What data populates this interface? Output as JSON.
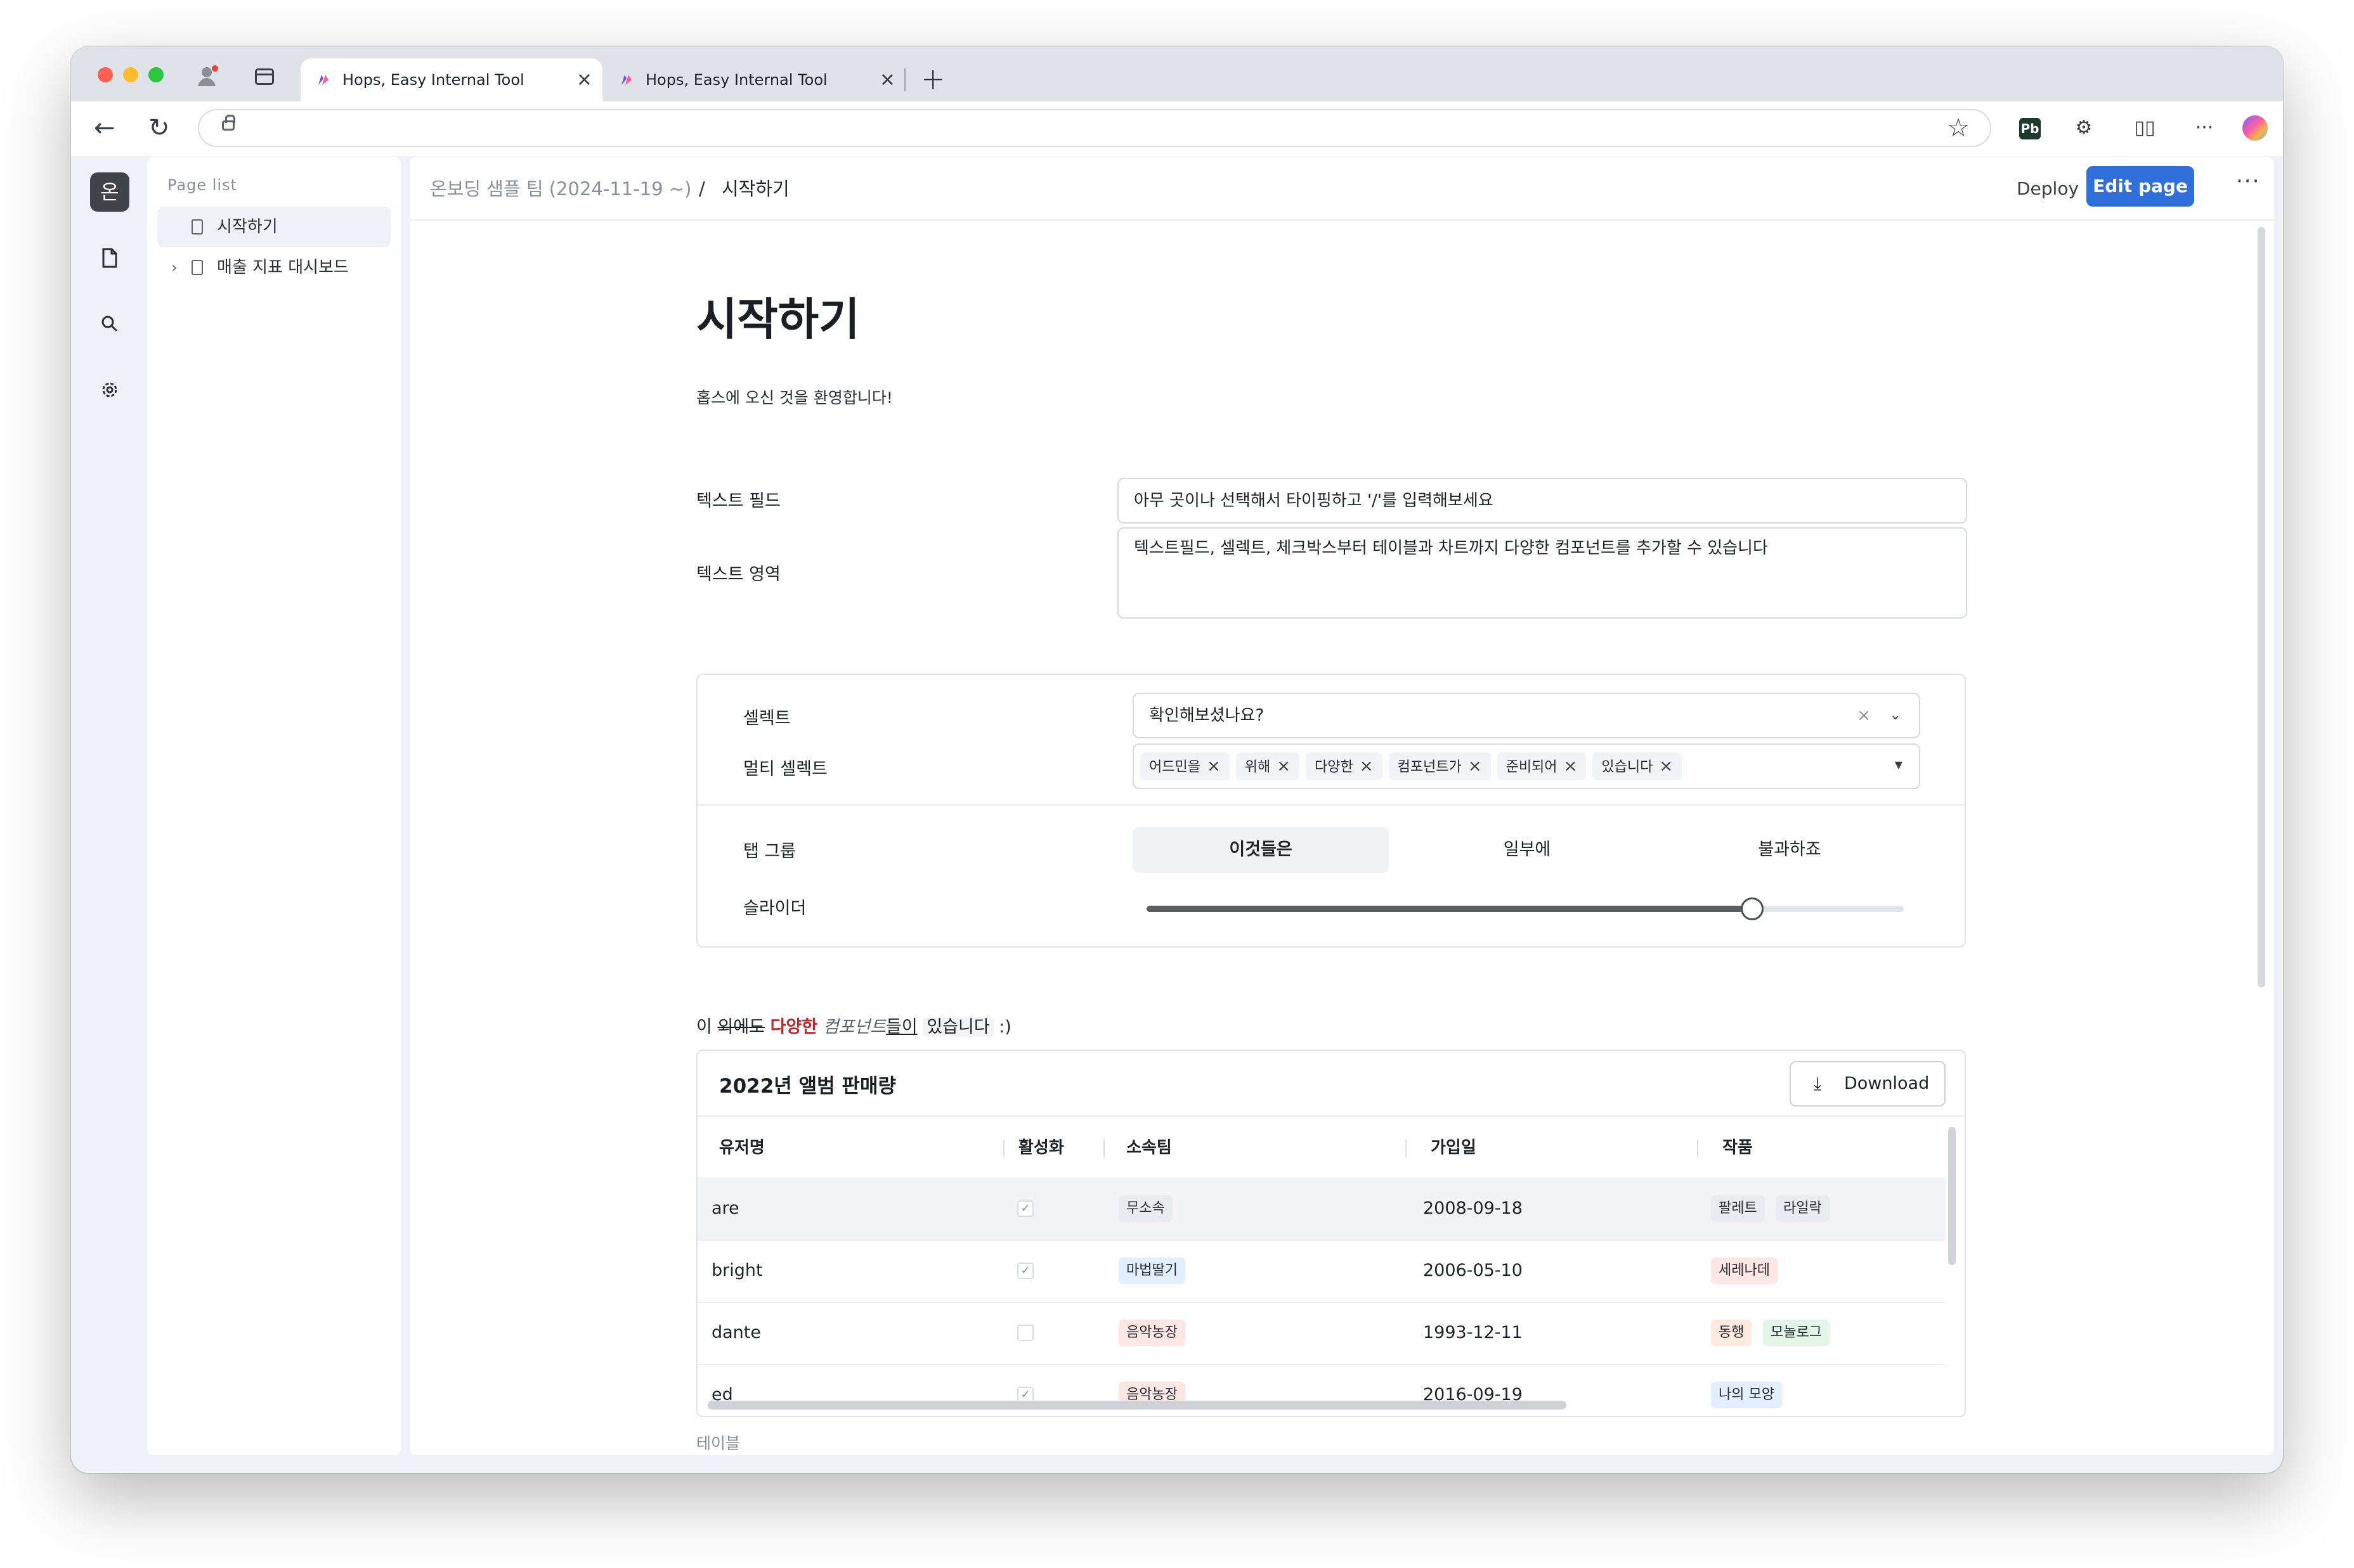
{
  "browser": {
    "tabs": [
      {
        "title": "Hops, Easy Internal Tool",
        "active": true
      },
      {
        "title": "Hops, Easy Internal Tool",
        "active": false
      }
    ],
    "address": ""
  },
  "sidebar_rail": {
    "workspace_initial": "온",
    "items": [
      "doc-icon",
      "search-icon",
      "gear-icon"
    ]
  },
  "page_list": {
    "title": "Page list",
    "items": [
      {
        "label": "시작하기",
        "selected": true
      },
      {
        "label": "매출 지표 대시보드",
        "selected": false
      }
    ]
  },
  "topbar": {
    "team": "온보딩 샘플 팀 (2024-11-19 ~)",
    "separator": "/",
    "current_page": "시작하기",
    "deploy_label": "Deploy",
    "edit_label": "Edit page",
    "more_label": "···"
  },
  "content": {
    "heading": "시작하기",
    "welcome": "홉스에 오신 것을 환영합니다!",
    "text_field": {
      "label": "텍스트 필드",
      "value": "아무 곳이나 선택해서 타이핑하고 '/'를 입력해보세요"
    },
    "text_area": {
      "label": "텍스트 영역",
      "value": "텍스트필드, 셀렉트, 체크박스부터 테이블과 차트까지 다양한 컴포넌트를 추가할 수 있습니다"
    },
    "select": {
      "label": "셀렉트",
      "value": "확인해보셨나요?"
    },
    "multi_select": {
      "label": "멀티 셀렉트",
      "chips": [
        "어드민을",
        "위해",
        "다양한",
        "컴포넌트가",
        "준비되어",
        "있습니다"
      ]
    },
    "tab_group": {
      "label": "탭 그룹",
      "options": [
        "이것들은",
        "일부에",
        "불과하죠"
      ],
      "selected_index": 0
    },
    "slider": {
      "label": "슬라이더",
      "value_fraction": 0.8
    },
    "rich_text": {
      "t1": "이 ",
      "t2": "외에도",
      "t3": " ",
      "t4": "다양한",
      "t5": " ",
      "t6": "컴포넌트",
      "t7": "들이",
      "t8": " ",
      "t9": "있습니다",
      "t10": " :)"
    }
  },
  "table": {
    "title": "2022년 앨범 판매량",
    "download_label": "Download",
    "columns": [
      "유저명",
      "활성화",
      "소속팀",
      "가입일",
      "작품"
    ],
    "rows": [
      {
        "user": "are",
        "active": true,
        "team": "무소속",
        "joined": "2008-09-18",
        "works": [
          "팔레트",
          "라일락"
        ]
      },
      {
        "user": "bright",
        "active": true,
        "team": "마법딸기",
        "joined": "2006-05-10",
        "works": [
          "세레나데"
        ]
      },
      {
        "user": "dante",
        "active": false,
        "team": "음악농장",
        "joined": "1993-12-11",
        "works": [
          "동행",
          "모놀로그"
        ]
      },
      {
        "user": "ed",
        "active": true,
        "team": "음악농장",
        "joined": "2016-09-19",
        "works": [
          "나의 모양"
        ]
      }
    ],
    "caption": "테이블"
  },
  "colors": {
    "accent": "#2f6fdb",
    "rich_red": "#c0262d",
    "tag_gray": "#e9ecf0",
    "tag_blue": "#e3efff",
    "tag_red": "#fde7e4",
    "tag_orange": "#fdebe0",
    "tag_green": "#e3f5e6"
  }
}
